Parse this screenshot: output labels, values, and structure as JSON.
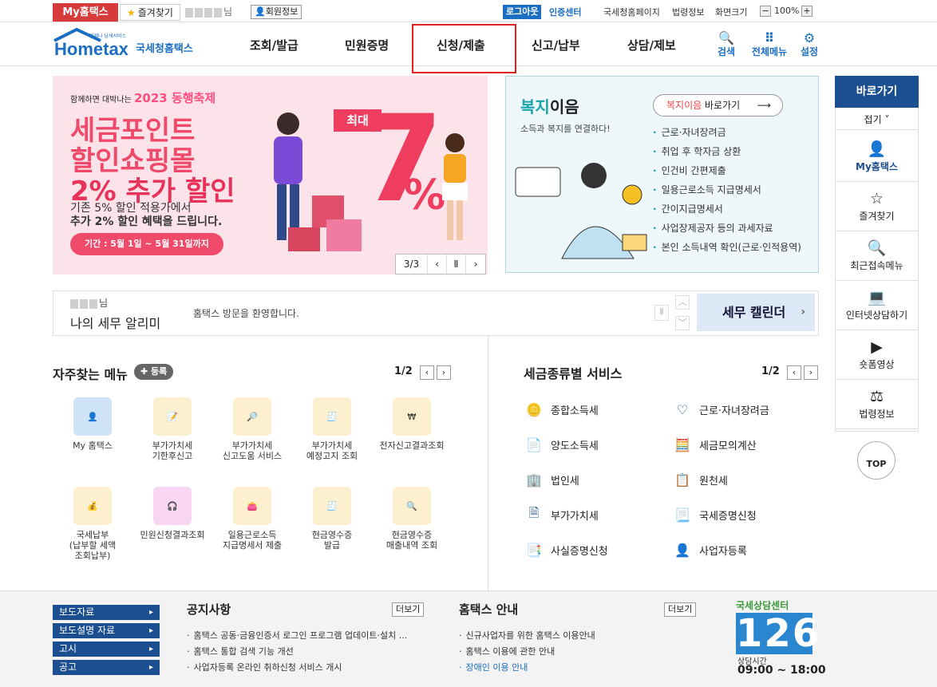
{
  "topbar": {
    "myhome": "My홈택스",
    "favorites": "즐겨찾기",
    "user_suffix": "님",
    "member_info": "회원정보",
    "logout": "로그아웃",
    "cert_center": "인증센터",
    "links": [
      "국세청홈페이지",
      "법령정보",
      "화면크기"
    ],
    "zoom": "100%"
  },
  "logo": {
    "small": "언제나 납세서비스",
    "brand": "Hometax",
    "org": "국세청홈택스"
  },
  "gnb": [
    "조회/발급",
    "민원증명",
    "신청/제출",
    "신고/납부",
    "상담/제보"
  ],
  "tools": [
    {
      "label": "검색",
      "icon": "search-icon"
    },
    {
      "label": "전체메뉴",
      "icon": "grid-menu-icon"
    },
    {
      "label": "설정",
      "icon": "gear-icon"
    }
  ],
  "banner": {
    "festival_pre": "함께하면 대박나는",
    "festival": "2023 동행축제",
    "title1": "세금포인트",
    "title2": "할인쇼핑몰",
    "title3": "2% 추가 할인",
    "sub1": "기존 5% 할인 적용가에서",
    "sub2": "추가 2% 할인 혜택을 드립니다.",
    "period": "기간 : 5월 1일 ~ 5월 31일까지",
    "badge": "최대",
    "big": "7",
    "pct": "%",
    "page": "3/3"
  },
  "welfare": {
    "title_a": "복지",
    "title_b": "이음",
    "sub": "소득과 복지를 연결하다!",
    "link_a": "복지이음",
    "link_b": " 바로가기",
    "items": [
      "근로·자녀장려금",
      "취업 후 학자금 상환",
      "인건비 간편제출",
      "일용근로소득 지급명세서",
      "간이지급명세서",
      "사업장제공자 등의 과세자료",
      "본인 소득내역 확인(근로·인적용역)"
    ]
  },
  "alert": {
    "name_suffix": "님",
    "title": "나의 세무 알리미",
    "message": "홈택스 방문을 환영합니다.",
    "calendar": "세무 캘린더"
  },
  "frequent": {
    "title": "자주찾는 메뉴",
    "register": "등록",
    "page": "1/2",
    "items": [
      {
        "label": "My 홈택스",
        "icon": "user-icon",
        "color": "#cfe3f7"
      },
      {
        "label": "부가가치세\n기한후신고",
        "icon": "vat-doc-icon",
        "color": "#fdf0cf"
      },
      {
        "label": "부가가치세\n신고도움 서비스",
        "icon": "document-search-icon",
        "color": "#fdf0cf"
      },
      {
        "label": "부가가치세\n예정고지 조회",
        "icon": "bill-search-icon",
        "color": "#fdf0cf"
      },
      {
        "label": "전자신고결과조회",
        "icon": "won-search-icon",
        "color": "#fdf0cf"
      },
      {
        "label": "국세납부\n(납부할 세액\n조회납부)",
        "icon": "money-bag-icon",
        "color": "#fdf0cf"
      },
      {
        "label": "민원신청결과조회",
        "icon": "headset-icon",
        "color": "#f9d7f4"
      },
      {
        "label": "일용근로소득\n지급명세서 제출",
        "icon": "wallet-icon",
        "color": "#fdf0cf"
      },
      {
        "label": "현금영수증\n발급",
        "icon": "receipt-icon",
        "color": "#fdf0cf"
      },
      {
        "label": "현금영수증\n매출내역 조회",
        "icon": "receipt-search-icon",
        "color": "#fdf0cf"
      }
    ]
  },
  "taxservice": {
    "title": "세금종류별 서비스",
    "page": "1/2",
    "items": [
      {
        "label": "종합소득세",
        "icon": "coin-hand-icon"
      },
      {
        "label": "근로·자녀장려금",
        "icon": "heart-hand-icon"
      },
      {
        "label": "양도소득세",
        "icon": "document-pen-icon"
      },
      {
        "label": "세금모의계산",
        "icon": "calculator-icon"
      },
      {
        "label": "법인세",
        "icon": "building-icon"
      },
      {
        "label": "원천세",
        "icon": "salary-doc-icon"
      },
      {
        "label": "부가가치세",
        "icon": "vat-icon"
      },
      {
        "label": "국세증명신청",
        "icon": "certificate-icon"
      },
      {
        "label": "사실증명신청",
        "icon": "list-doc-icon"
      },
      {
        "label": "사업자등록",
        "icon": "person-icon"
      }
    ]
  },
  "quick": {
    "title": "바로가기",
    "fold": "접기",
    "items": [
      {
        "label": "My홈택스",
        "icon": "user-icon"
      },
      {
        "label": "즐겨찾기",
        "icon": "star-icon"
      },
      {
        "label": "최근접속메뉴",
        "icon": "recent-search-icon"
      },
      {
        "label": "인터넷상담하기",
        "icon": "laptop-chat-icon"
      },
      {
        "label": "숏폼영상",
        "icon": "play-icon"
      },
      {
        "label": "법령정보",
        "icon": "gavel-icon"
      }
    ],
    "top": "TOP"
  },
  "footer": {
    "buttons": [
      "보도자료",
      "보도설명 자료",
      "고시",
      "공고"
    ],
    "notice_title": "공지사항",
    "more": "더보기",
    "notices": [
      "홈택스 공동·금융인증서 로그인 프로그램 업데이트·설치 ...",
      "홈택스 통합 검색 기능 개선",
      "사업자등록 온라인 취하신청 서비스 개시"
    ],
    "guide_title": "홈택스 안내",
    "guides": [
      "신규사업자를 위한 홈택스 이용안내",
      "홈택스 이용에 관한 안내",
      "장애인 이용 안내"
    ],
    "cs_title": "국세상담센터",
    "cs_number": "126",
    "cs_time": "상담시간",
    "cs_hours": "09:00 ~ 18:00"
  }
}
